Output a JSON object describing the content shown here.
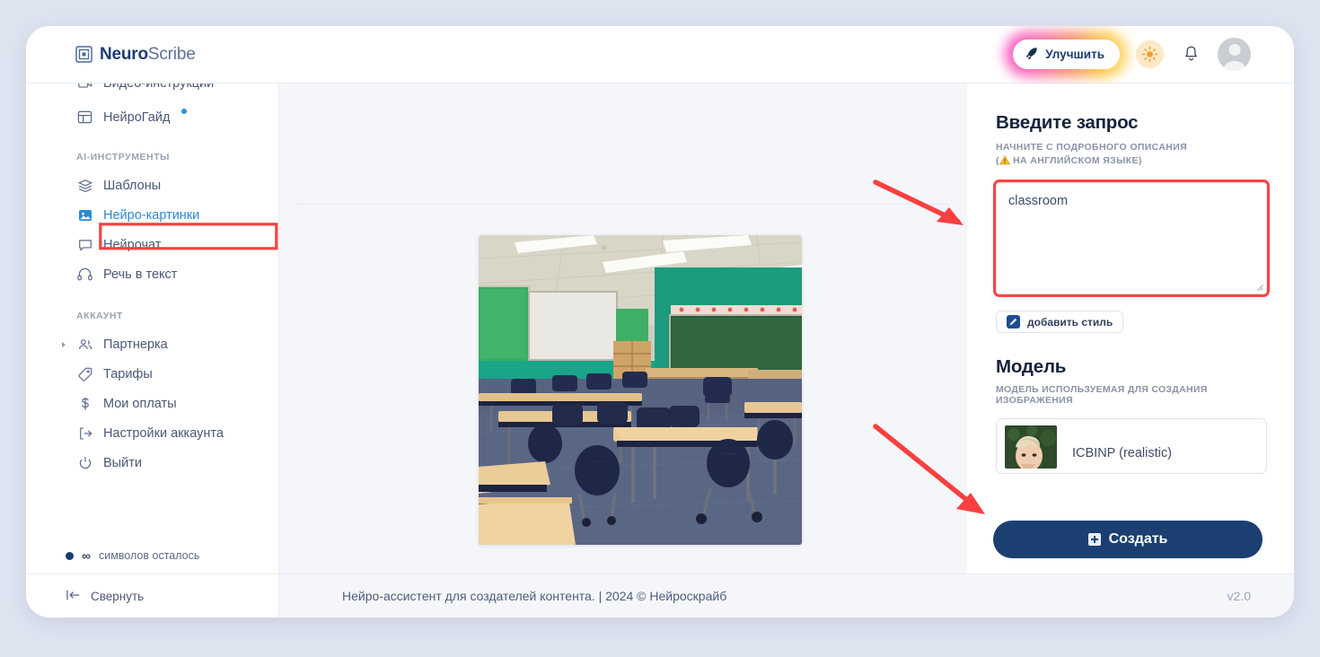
{
  "brand": {
    "bold": "Neuro",
    "light": "Scribe",
    "logo_icon": "nested-squares-logo"
  },
  "header": {
    "improve_label": "Улучшить",
    "improve_icon": "rocket-icon",
    "theme_icon": "sun-icon",
    "notifications_icon": "bell-icon",
    "avatar_icon": "user-avatar"
  },
  "sidebar": {
    "top_clipped_item": {
      "label": "Видео-инструкции",
      "icon": "video-icon"
    },
    "guide_item": {
      "label": "НейроГайд",
      "icon": "table-grid-icon",
      "badge": "new-dot"
    },
    "groups": [
      {
        "label": "AI-ИНСТРУМЕНТЫ",
        "items": [
          {
            "label": "Шаблоны",
            "icon": "layers-icon",
            "active": false
          },
          {
            "label": "Нейро-картинки",
            "icon": "image-icon",
            "active": true
          },
          {
            "label": "Нейрочат",
            "icon": "chat-bubble-icon",
            "active": false
          },
          {
            "label": "Речь в текст",
            "icon": "headphones-icon",
            "active": false
          }
        ]
      },
      {
        "label": "АККАУНТ",
        "items": [
          {
            "label": "Партнерка",
            "icon": "users-icon",
            "expandable": true
          },
          {
            "label": "Тарифы",
            "icon": "tag-icon"
          },
          {
            "label": "Мои оплаты",
            "icon": "dollar-icon"
          },
          {
            "label": "Настройки аккаунта",
            "icon": "bracket-arrow-icon"
          },
          {
            "label": "Выйти",
            "icon": "power-icon"
          }
        ]
      }
    ],
    "quota": {
      "infinity": "∞",
      "text": "символов осталось",
      "dot_color": "#1b3c73"
    },
    "collapse": {
      "label": "Свернуть",
      "icon": "collapse-left-icon"
    }
  },
  "main": {
    "generated_image_alt": "classroom"
  },
  "prompt_panel": {
    "title": "Введите запрос",
    "subtitle_line1": "НАЧНИТЕ С ПОДРОБНОГО ОПИСАНИЯ",
    "subtitle_line2_pre": "(",
    "subtitle_line2_post": " НА АНГЛИЙСКОМ ЯЗЫКЕ)",
    "warning_icon": "warning-triangle-icon",
    "prompt_value": "classroom",
    "prompt_placeholder": "",
    "style_button": {
      "label": "добавить стиль",
      "icon": "pencil-icon"
    }
  },
  "model_panel": {
    "title": "Модель",
    "subtitle": "МОДЕЛЬ ИСПОЛЬЗУЕМАЯ ДЛЯ СОЗДАНИЯ ИЗОБРАЖЕНИЯ",
    "selected_model": "ICBINP (realistic)",
    "thumb_icon": "model-preview-thumbnail"
  },
  "create_button": {
    "label": "Создать",
    "icon": "plus-square-icon",
    "color": "#1b3f71"
  },
  "footer": {
    "text": "Нейро-ассистент для создателей контента.  | 2024 © Нейроскрайб",
    "version": "v2.0"
  },
  "annotations": {
    "color": "#f94040",
    "arrow_prompt": "arrow-pointing-to-prompt-box",
    "arrow_create": "arrow-pointing-to-create-button",
    "highlight_sidebar": "red-box-around-neuro-pictures",
    "highlight_prompt": "red-box-around-prompt-textarea"
  }
}
